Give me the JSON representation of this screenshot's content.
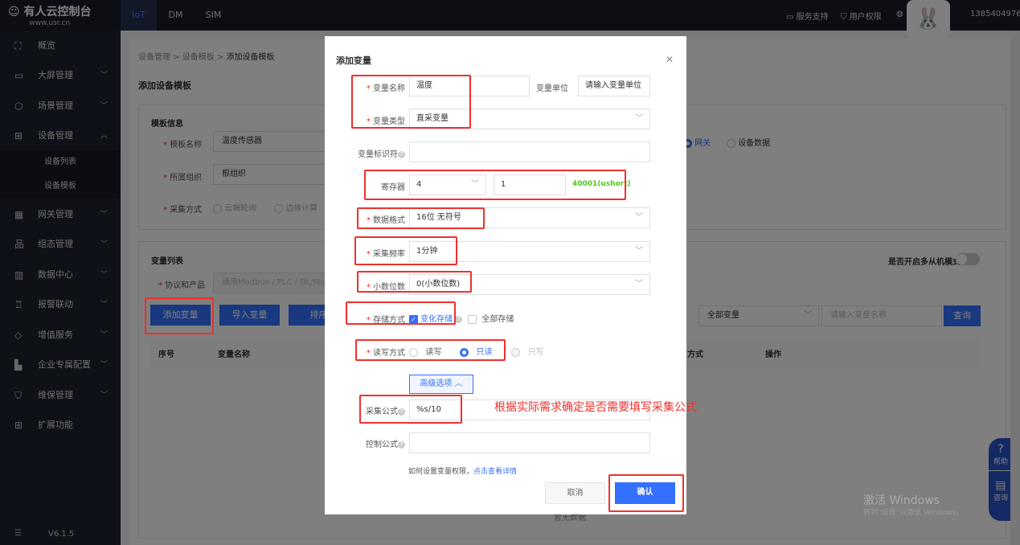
{
  "header": {
    "logo_title": "有人云控制台",
    "logo_url": "www.usr.cn",
    "tabs": [
      "IoT",
      "DM",
      "SIM"
    ],
    "service": "服务支持",
    "permissions": "用户权限",
    "phone": "1385404976"
  },
  "sidebar": {
    "items": [
      {
        "label": "概览",
        "icon": "scan-icon"
      },
      {
        "label": "大屏管理",
        "icon": "monitor-icon"
      },
      {
        "label": "场景管理",
        "icon": "cube-icon"
      },
      {
        "label": "设备管理",
        "icon": "device-icon"
      },
      {
        "label": "设备列表"
      },
      {
        "label": "设备模板"
      },
      {
        "label": "网关管理",
        "icon": "gateway-icon"
      },
      {
        "label": "组态管理",
        "icon": "topology-icon"
      },
      {
        "label": "数据中心",
        "icon": "chart-icon"
      },
      {
        "label": "报警联动",
        "icon": "alarm-icon"
      },
      {
        "label": "增值服务",
        "icon": "diamond-icon"
      },
      {
        "label": "企业专属配置",
        "icon": "enterprise-icon"
      },
      {
        "label": "维保管理",
        "icon": "shield-icon"
      },
      {
        "label": "扩展功能",
        "icon": "grid-icon"
      }
    ],
    "version": "V6.1.5"
  },
  "page": {
    "breadcrumb": [
      "设备管理",
      "设备模板",
      "添加设备模板"
    ],
    "title": "添加设备模板",
    "template_info": {
      "heading": "模板信息",
      "name_label": "模板名称",
      "name_value": "温度传感器",
      "org_label": "所属组织",
      "org_value": "根组织",
      "collect_label": "采集方式",
      "collect_opts": [
        "云端轮询",
        "边缘计算"
      ],
      "source_opts": [
        "网关",
        "设备数据"
      ]
    },
    "var_list": {
      "heading": "变量列表",
      "protocol_label": "协议和产品",
      "protocol_value": "通用Modbus / PLC / DL/Modbus",
      "multi_slave": "是否开启多从机模式",
      "buttons": [
        "添加变量",
        "导入变量",
        "排序"
      ],
      "filter": "全部变量",
      "search_ph": "请输入变量名称",
      "query": "查询",
      "columns": [
        "序号",
        "变量名称",
        "方式",
        "操作"
      ],
      "empty": "暂无数据"
    }
  },
  "modal": {
    "title": "添加变量",
    "name_label": "变量名称",
    "name_value": "温度",
    "unit_label": "变量单位",
    "unit_ph": "请输入变量单位",
    "type_label": "变量类型",
    "type_value": "直采变量",
    "ident_label": "变量标识符",
    "reg_label": "寄存器",
    "reg_type": "4",
    "reg_addr": "1",
    "reg_hint": "40001(ushort)",
    "format_label": "数据格式",
    "format_value": "16位 无符号",
    "freq_label": "采集频率",
    "freq_value": "1分钟",
    "dec_label": "小数位数",
    "dec_value": "0(小数位数)",
    "store_label": "存储方式",
    "store_opts": [
      "变化存储",
      "全部存储"
    ],
    "rw_label": "读写方式",
    "rw_opts": [
      "读写",
      "只读",
      "只写"
    ],
    "advanced": "高级选项",
    "formula_label": "采集公式",
    "formula_value": "%s/10",
    "control_label": "控制公式",
    "help_text": "如何设置变量权限，",
    "help_link": "点击查看详情",
    "cancel": "取消",
    "confirm": "确认"
  },
  "annotation": "根据实际需求确定是否需要填写采集公式",
  "float": {
    "help": "帮助",
    "consult": "咨询"
  },
  "watermark": {
    "title": "激活 Windows",
    "sub": "转到“设置”以激活 Windows。"
  },
  "colors": {
    "primary": "#3370ff",
    "annotation": "#f0302c",
    "hint": "#52c41a"
  }
}
